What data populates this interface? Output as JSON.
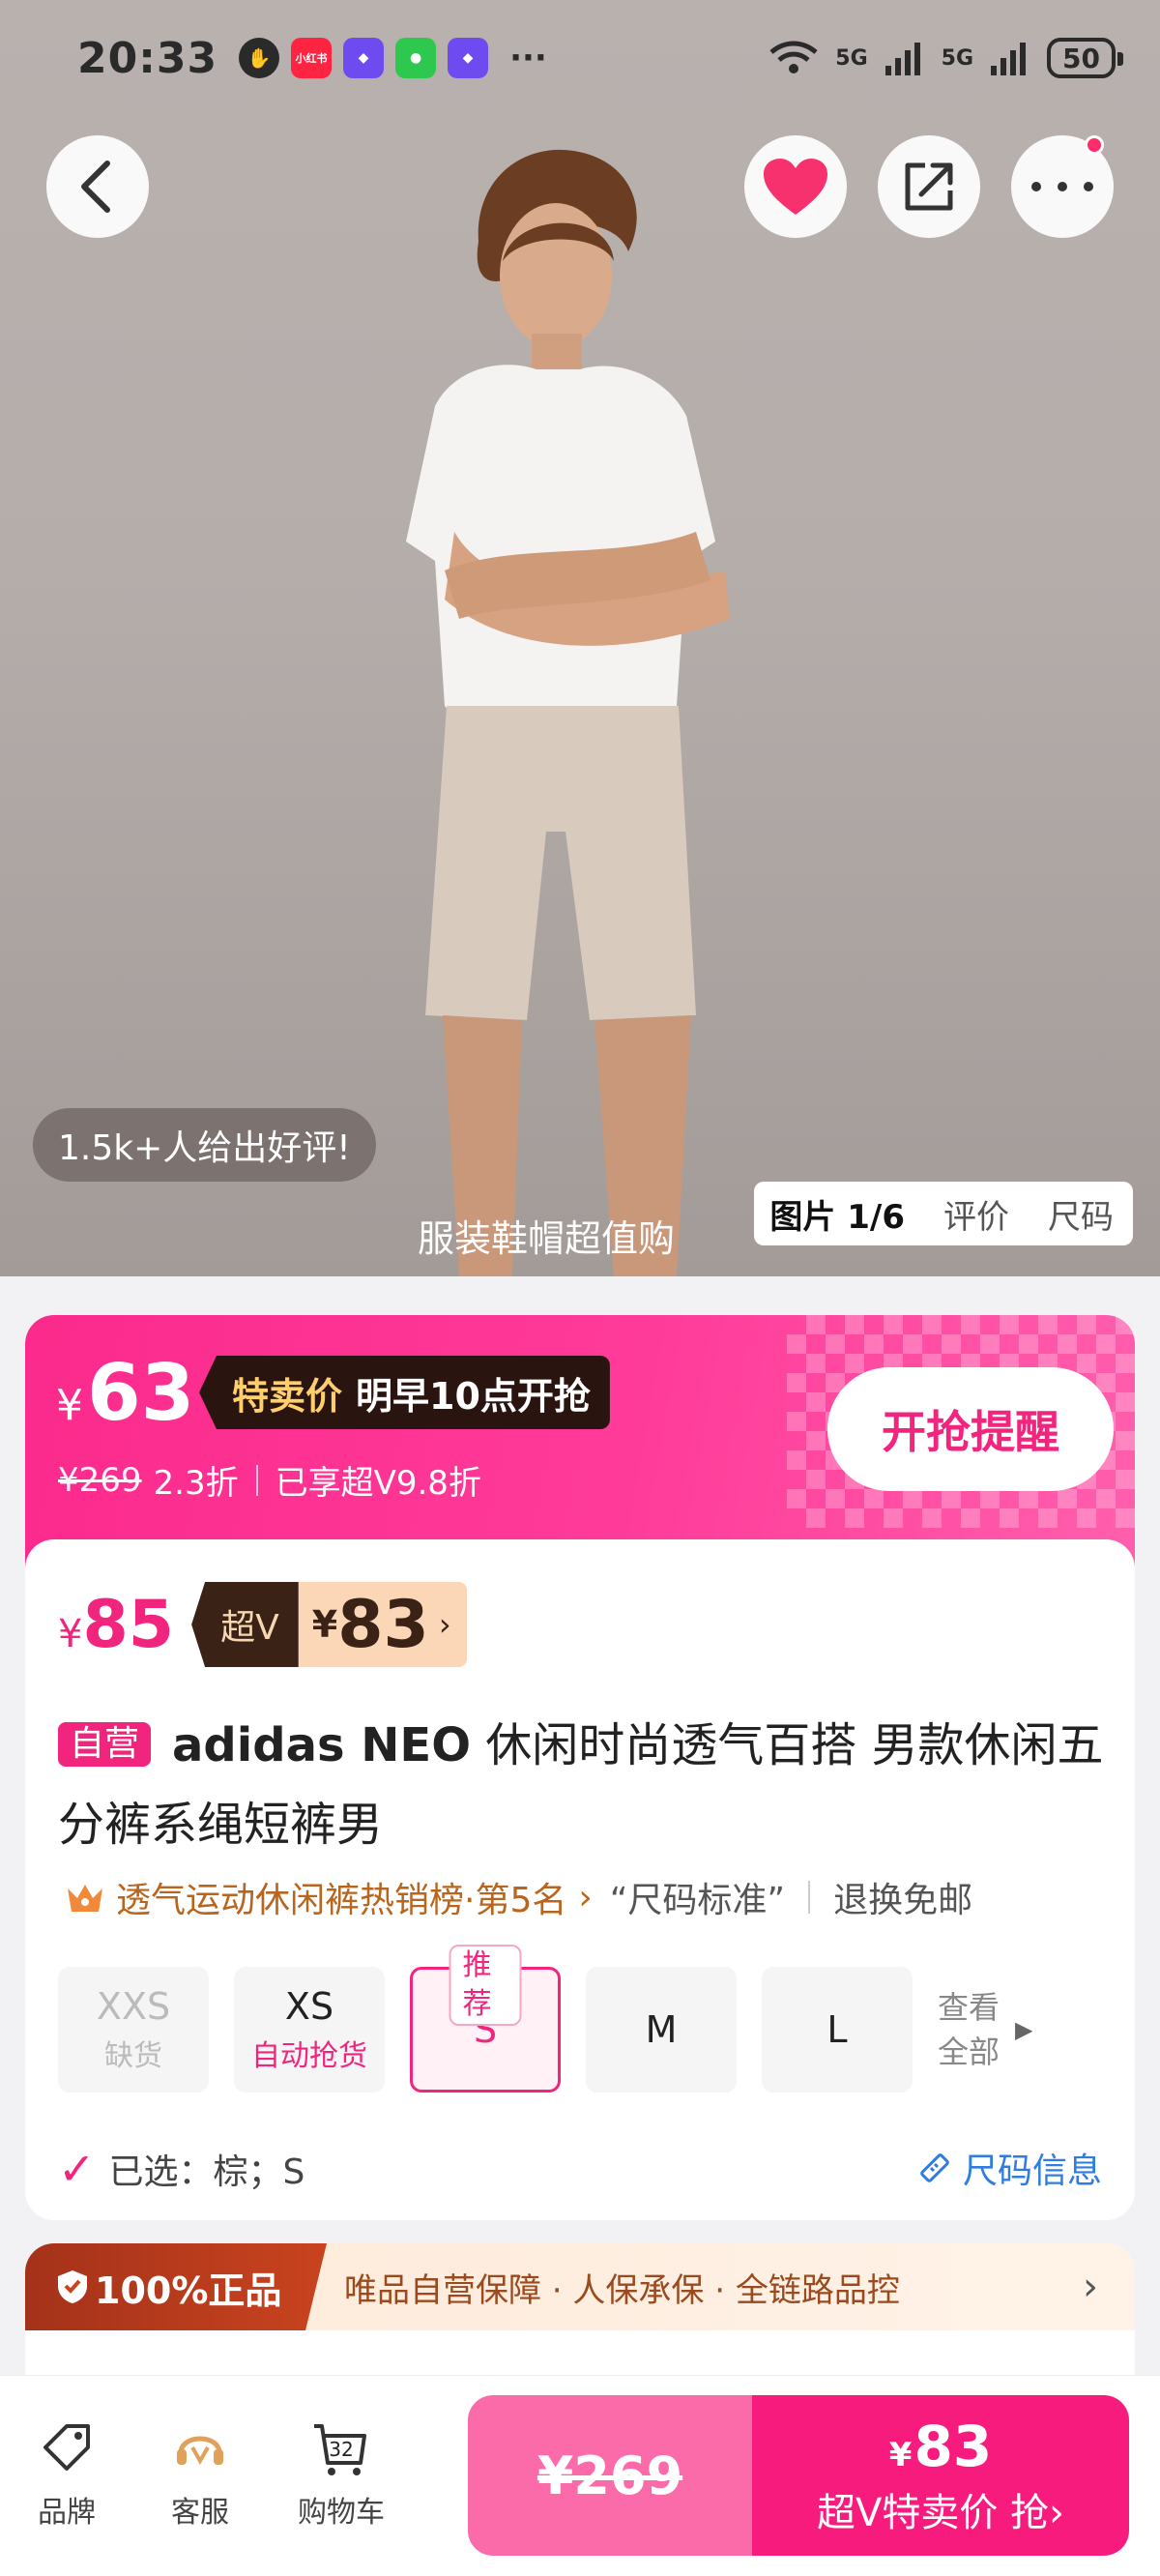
{
  "status_bar": {
    "time": "20:33",
    "app_badge_text": "小红书",
    "network_left": "5G",
    "network_right": "5G",
    "battery": "50"
  },
  "hero": {
    "review_badge": "1.5k+人给出好评!",
    "caption": "服装鞋帽超值购",
    "tabs": {
      "active": "图片 1/6",
      "review": "评价",
      "size": "尺码"
    }
  },
  "promo": {
    "yen": "¥",
    "price": "63",
    "flash_label": "特卖价",
    "flash_time": "明早10点开抢",
    "original_price": "¥269",
    "discount": "2.3折",
    "vip_discount": "已享超V9.8折",
    "remind_button": "开抢提醒"
  },
  "vip": {
    "yen": "¥",
    "price": "85",
    "vip_label": "超V",
    "vip_price": "83",
    "chevron": "›"
  },
  "product": {
    "self_tag": "自营",
    "brand": "adidas NEO",
    "title": " 休闲时尚透气百搭 男款休闲五分裤系绳短裤男"
  },
  "info": {
    "rank": "透气运动休闲裤热销榜·第5名",
    "chevron": "›",
    "size_std": "“尺码标准”",
    "return_policy": "退换免邮"
  },
  "sizes": [
    {
      "label": "XXS",
      "sub": "缺货"
    },
    {
      "label": "XS",
      "sub": "自动抢货"
    },
    {
      "label": "S",
      "tag": "推荐"
    },
    {
      "label": "M"
    },
    {
      "label": "L"
    }
  ],
  "size_all": {
    "line1": "查看",
    "line2": "全部"
  },
  "selected": {
    "text": "已选：棕；S"
  },
  "size_info": "尺码信息",
  "guarantee": {
    "badge": "100%正品",
    "text": "唯品自营保障 · 人保承保 · 全链路品控",
    "chevron": "›"
  },
  "bottom_nav": {
    "brand": "品牌",
    "service": "客服",
    "cart": "购物车",
    "cart_count": "32"
  },
  "buy": {
    "original_price": "¥269",
    "yen": "¥",
    "price": "83",
    "label": "超V特卖价 抢›"
  },
  "colors": {
    "accent_pink": "#f2257e",
    "vip_dark": "#3a2216",
    "gold": "#ffcf6b"
  }
}
